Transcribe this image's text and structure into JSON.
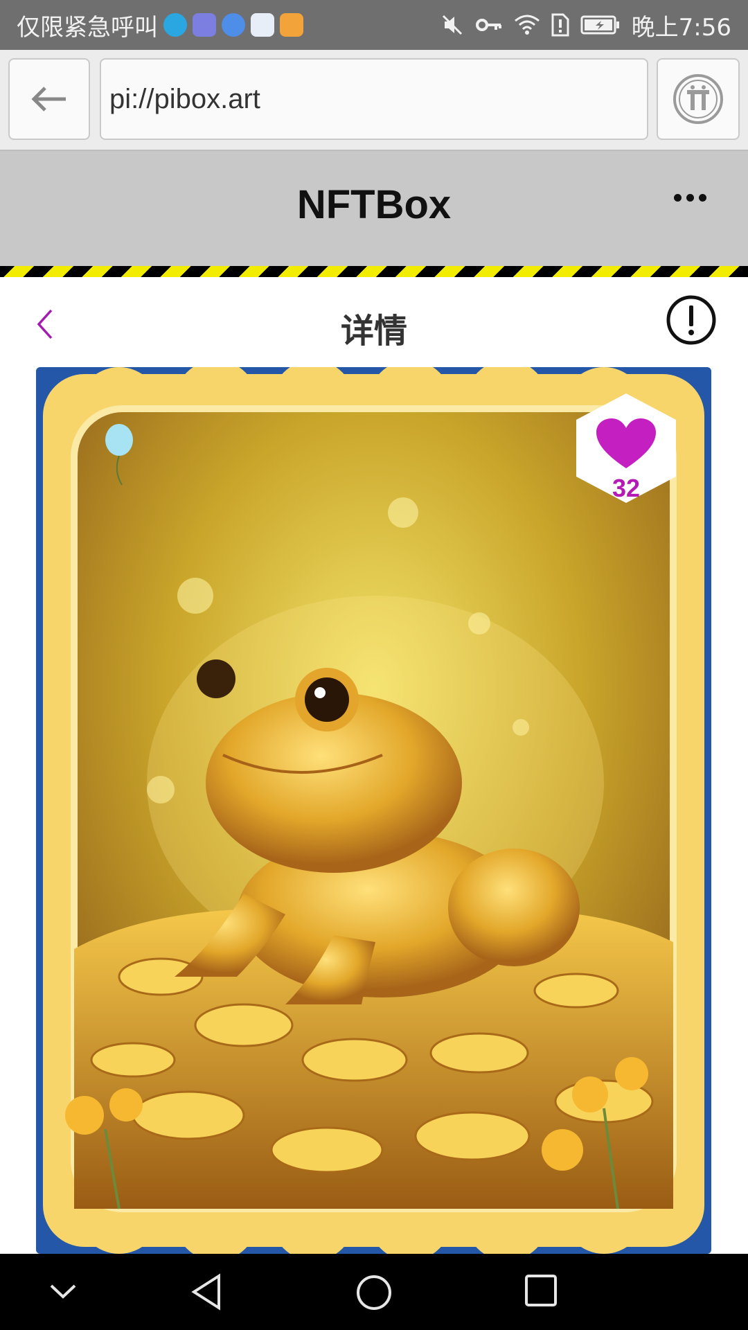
{
  "status_bar": {
    "carrier_text": "仅限紧急呼叫",
    "time": "晚上7:56",
    "app_icons": [
      "swirl-app-icon",
      "music-app-icon",
      "browser-app-icon",
      "scanner-app-icon",
      "orange-app-icon"
    ],
    "status_icons": [
      "mute-icon",
      "key-icon",
      "wifi-icon",
      "sim-alert-icon",
      "battery-icon"
    ]
  },
  "browser": {
    "url": "pi://pibox.art"
  },
  "app": {
    "title": "NFTBox"
  },
  "detail": {
    "title": "详情"
  },
  "nft": {
    "likes": "32",
    "image_subject": "golden toad on coins"
  },
  "colors": {
    "accent_purple": "#a21caf",
    "card_blue": "#2557a9",
    "frame_yellow": "#f7d56a"
  }
}
